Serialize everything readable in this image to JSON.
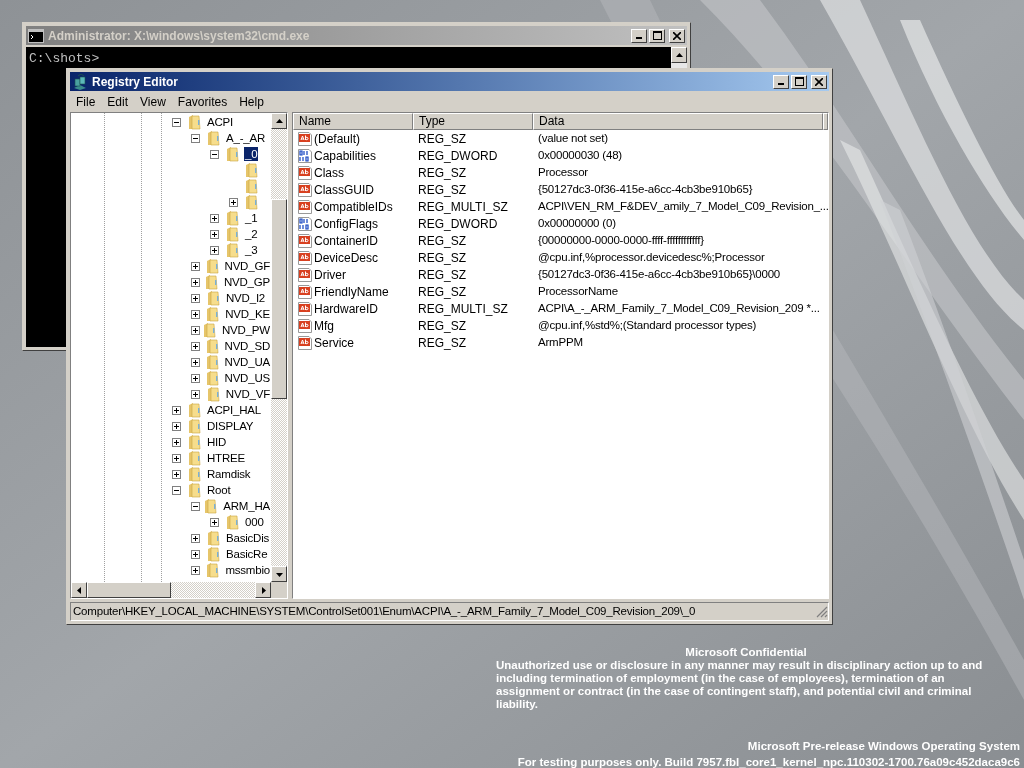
{
  "console_window": {
    "title": "Administrator: X:\\windows\\system32\\cmd.exe",
    "active": false,
    "prompt": "C:\\shots>"
  },
  "registry_window": {
    "title": "Registry Editor",
    "active": true,
    "menu": [
      "File",
      "Edit",
      "View",
      "Favorites",
      "Help"
    ],
    "tree": [
      {
        "label": "ACPI",
        "expanded": true,
        "selected": false,
        "children": [
          {
            "label": "A_-_AR",
            "expanded": true,
            "selected": false,
            "children": [
              {
                "label": "_0",
                "expanded": true,
                "selected": true,
                "children": [
                  {
                    "selected": false
                  },
                  {
                    "selected": false
                  },
                  {
                    "expanded": false,
                    "selected": false
                  }
                ]
              },
              {
                "label": "_1",
                "expanded": false,
                "selected": false
              },
              {
                "label": "_2",
                "expanded": false,
                "selected": false
              },
              {
                "label": "_3",
                "expanded": false,
                "selected": false
              }
            ]
          },
          {
            "label": "NVD_GF",
            "expanded": false,
            "selected": false
          },
          {
            "label": "NVD_GP",
            "expanded": false,
            "selected": false
          },
          {
            "label": "NVD_I2",
            "expanded": false,
            "selected": false
          },
          {
            "label": "NVD_KE",
            "expanded": false,
            "selected": false
          },
          {
            "label": "NVD_PW",
            "expanded": false,
            "selected": false
          },
          {
            "label": "NVD_SD",
            "expanded": false,
            "selected": false
          },
          {
            "label": "NVD_UA",
            "expanded": false,
            "selected": false
          },
          {
            "label": "NVD_US",
            "expanded": false,
            "selected": false
          },
          {
            "label": "NVD_VF",
            "expanded": false,
            "selected": false
          }
        ]
      },
      {
        "label": "ACPI_HAL",
        "expanded": false,
        "selected": false
      },
      {
        "label": "DISPLAY",
        "expanded": false,
        "selected": false
      },
      {
        "label": "HID",
        "expanded": false,
        "selected": false
      },
      {
        "label": "HTREE",
        "expanded": false,
        "selected": false
      },
      {
        "label": "Ramdisk",
        "expanded": false,
        "selected": false
      },
      {
        "label": "Root",
        "expanded": true,
        "selected": false,
        "children": [
          {
            "label": "ARM_HA",
            "expanded": true,
            "selected": false,
            "children": [
              {
                "label": "000",
                "expanded": false,
                "selected": false
              }
            ]
          },
          {
            "label": "BasicDis",
            "expanded": false,
            "selected": false
          },
          {
            "label": "BasicRe",
            "expanded": false,
            "selected": false
          },
          {
            "label": "mssmbio",
            "expanded": false,
            "selected": false
          }
        ]
      }
    ],
    "columns": [
      "Name",
      "Type",
      "Data"
    ],
    "values": [
      {
        "kind": "string",
        "name": "(Default)",
        "type": "REG_SZ",
        "data": "(value not set)"
      },
      {
        "kind": "binary",
        "name": "Capabilities",
        "type": "REG_DWORD",
        "data": "0x00000030 (48)"
      },
      {
        "kind": "string",
        "name": "Class",
        "type": "REG_SZ",
        "data": "Processor"
      },
      {
        "kind": "string",
        "name": "ClassGUID",
        "type": "REG_SZ",
        "data": "{50127dc3-0f36-415e-a6cc-4cb3be910b65}"
      },
      {
        "kind": "string",
        "name": "CompatibleIDs",
        "type": "REG_MULTI_SZ",
        "data": "ACPI\\VEN_RM_F&DEV_amily_7_Model_C09_Revision_..."
      },
      {
        "kind": "binary",
        "name": "ConfigFlags",
        "type": "REG_DWORD",
        "data": "0x00000000 (0)"
      },
      {
        "kind": "string",
        "name": "ContainerID",
        "type": "REG_SZ",
        "data": "{00000000-0000-0000-ffff-ffffffffffff}"
      },
      {
        "kind": "string",
        "name": "DeviceDesc",
        "type": "REG_SZ",
        "data": "@cpu.inf,%processor.devicedesc%;Processor"
      },
      {
        "kind": "string",
        "name": "Driver",
        "type": "REG_SZ",
        "data": "{50127dc3-0f36-415e-a6cc-4cb3be910b65}\\0000"
      },
      {
        "kind": "string",
        "name": "FriendlyName",
        "type": "REG_SZ",
        "data": "ProcessorName"
      },
      {
        "kind": "string",
        "name": "HardwareID",
        "type": "REG_MULTI_SZ",
        "data": "ACPI\\A_-_ARM_Family_7_Model_C09_Revision_209 *..."
      },
      {
        "kind": "string",
        "name": "Mfg",
        "type": "REG_SZ",
        "data": "@cpu.inf,%std%;(Standard processor types)"
      },
      {
        "kind": "string",
        "name": "Service",
        "type": "REG_SZ",
        "data": "ArmPPM"
      }
    ],
    "status_bar": "Computer\\HKEY_LOCAL_MACHINE\\SYSTEM\\ControlSet001\\Enum\\ACPI\\A_-_ARM_Family_7_Model_C09_Revision_209\\_0"
  },
  "desktop_notice": {
    "title": "Microsoft Confidential",
    "body": "Unauthorized use or disclosure in any manner may result in disciplinary action up to and including termination of employment (in the case of employees), termination of an assignment or contract (in the case of contingent staff), and potential civil and criminal liability.",
    "os_name": "Microsoft Pre-release Windows Operating System",
    "build": "For testing purposes only. Build 7957.fbl_core1_kernel_npc.110302-1700.76a09c452daca9c6"
  }
}
